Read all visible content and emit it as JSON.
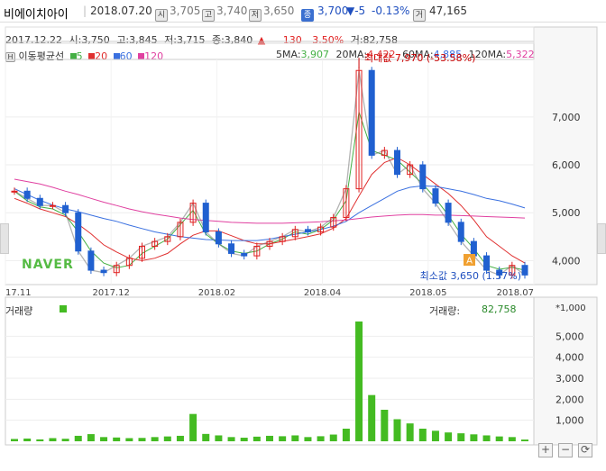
{
  "header": {
    "name": "비에이치아이",
    "date": "2018.07.20",
    "icon_open": "시",
    "open": "3,705",
    "icon_high": "고",
    "high": "3,740",
    "icon_low": "저",
    "low": "3,650",
    "icon_close": "종",
    "close": "3,700",
    "change": "▼-5",
    "change_pct": "-0.13%",
    "icon_volume": "거",
    "volume": "47,165"
  },
  "info": {
    "date": "2017.12.22",
    "open_label": "시:",
    "open": "3,750",
    "high_label": "고:",
    "high": "3,845",
    "low_label": "저:",
    "low": "3,715",
    "close_label": "종:",
    "close": "3,840",
    "arrow": "▲",
    "change": "130",
    "change_pct": "3.50%",
    "volume_label": "거:",
    "volume": "82,758"
  },
  "legend": {
    "icon": "H",
    "name": "이동평균선",
    "ma5": "5",
    "ma20": "20",
    "ma60": "60",
    "ma120": "120"
  },
  "ma_values": {
    "ma5_label": "5MA:",
    "ma5": "3,907",
    "ma20_label": "20MA:",
    "ma20": "4,422",
    "ma60_label": "60MA:",
    "ma60": "4,885",
    "ma120_label": "120MA:",
    "ma120": "5,322"
  },
  "scale_mode": "linear",
  "logo": "NAVER",
  "annotations": {
    "max": "최대값 7,970 (-53.58%)",
    "min": "최소값 3,650 (1.37%)",
    "min_badge": "A"
  },
  "volume_panel": {
    "title": "거래량",
    "value_label": "거래량:",
    "value": "82,758",
    "unit": "*1,000"
  },
  "controls": {
    "zoom_in": "+",
    "zoom_out": "−",
    "reset": "⟳",
    "left": "◀",
    "right": "▶"
  },
  "colors": {
    "up": "#e02020",
    "down": "#2060d0",
    "ma5": "#44b044",
    "ma20": "#e03030",
    "ma60": "#3a70e0",
    "ma120": "#e040a0",
    "volume": "#44bb22"
  },
  "chart_data": [
    {
      "type": "line",
      "title": "",
      "ylabel": "",
      "ylim": [
        3500,
        8200
      ],
      "yticks": [
        4000,
        5000,
        6000,
        7000
      ],
      "x_labels": [
        "17.11",
        "2017.12",
        "2018.02",
        "2018.04",
        "2018.05",
        "2018.07"
      ],
      "series": [
        {
          "name": "5",
          "values": [
            5450,
            5250,
            5120,
            5080,
            4950,
            4600,
            4200,
            3950,
            3850,
            3900,
            4150,
            4300,
            4450,
            4750,
            5050,
            4550,
            4350,
            4200,
            4150,
            4200,
            4350,
            4450,
            4600,
            4550,
            4650,
            4850,
            5250,
            7100,
            6300,
            6200,
            6100,
            5850,
            5600,
            5300,
            4950,
            4550,
            4250,
            3900,
            3820,
            3860,
            3800
          ]
        },
        {
          "name": "20",
          "values": [
            5300,
            5200,
            5080,
            5000,
            4920,
            4760,
            4560,
            4330,
            4180,
            4050,
            4000,
            4050,
            4150,
            4350,
            4530,
            4620,
            4620,
            4520,
            4420,
            4350,
            4350,
            4400,
            4450,
            4500,
            4560,
            4680,
            4880,
            5350,
            5800,
            6050,
            6150,
            6000,
            5800,
            5600,
            5400,
            5150,
            4850,
            4500,
            4300,
            4100,
            3950
          ]
        },
        {
          "name": "60",
          "values": [
            5500,
            5380,
            5260,
            5160,
            5080,
            5020,
            4950,
            4880,
            4820,
            4740,
            4670,
            4600,
            4550,
            4500,
            4470,
            4440,
            4430,
            4420,
            4420,
            4420,
            4450,
            4500,
            4550,
            4600,
            4650,
            4720,
            4820,
            5000,
            5150,
            5300,
            5450,
            5530,
            5560,
            5550,
            5500,
            5450,
            5380,
            5300,
            5250,
            5180,
            5100
          ]
        },
        {
          "name": "120",
          "values": [
            5700,
            5650,
            5600,
            5530,
            5450,
            5380,
            5300,
            5220,
            5150,
            5080,
            5020,
            4970,
            4930,
            4890,
            4860,
            4840,
            4820,
            4800,
            4790,
            4780,
            4780,
            4780,
            4790,
            4800,
            4810,
            4830,
            4850,
            4880,
            4910,
            4930,
            4950,
            4960,
            4960,
            4950,
            4950,
            4940,
            4930,
            4920,
            4910,
            4900,
            4890
          ]
        },
        {
          "name": "price",
          "values": [
            5450,
            5300,
            5150,
            5150,
            5000,
            4200,
            3800,
            3750,
            3900,
            4050,
            4300,
            4400,
            4500,
            4800,
            5200,
            4600,
            4350,
            4150,
            4100,
            4300,
            4400,
            4500,
            4650,
            4600,
            4700,
            4900,
            5500,
            7970,
            6200,
            6300,
            5800,
            6000,
            5500,
            5200,
            4800,
            4400,
            4100,
            3800,
            3700,
            3900,
            3700
          ]
        }
      ],
      "max_value": 7970,
      "min_value": 3650
    },
    {
      "type": "bar",
      "title": "거래량",
      "ylabel": "",
      "ylim": [
        0,
        6000
      ],
      "yticks": [
        1000,
        2000,
        3000,
        4000,
        5000
      ],
      "values": [
        110,
        130,
        90,
        150,
        120,
        260,
        340,
        200,
        180,
        150,
        160,
        200,
        230,
        260,
        1300,
        350,
        280,
        200,
        170,
        220,
        260,
        240,
        280,
        200,
        240,
        320,
        600,
        5700,
        2200,
        1500,
        1050,
        850,
        600,
        500,
        420,
        380,
        330,
        280,
        230,
        200,
        82
      ]
    }
  ]
}
